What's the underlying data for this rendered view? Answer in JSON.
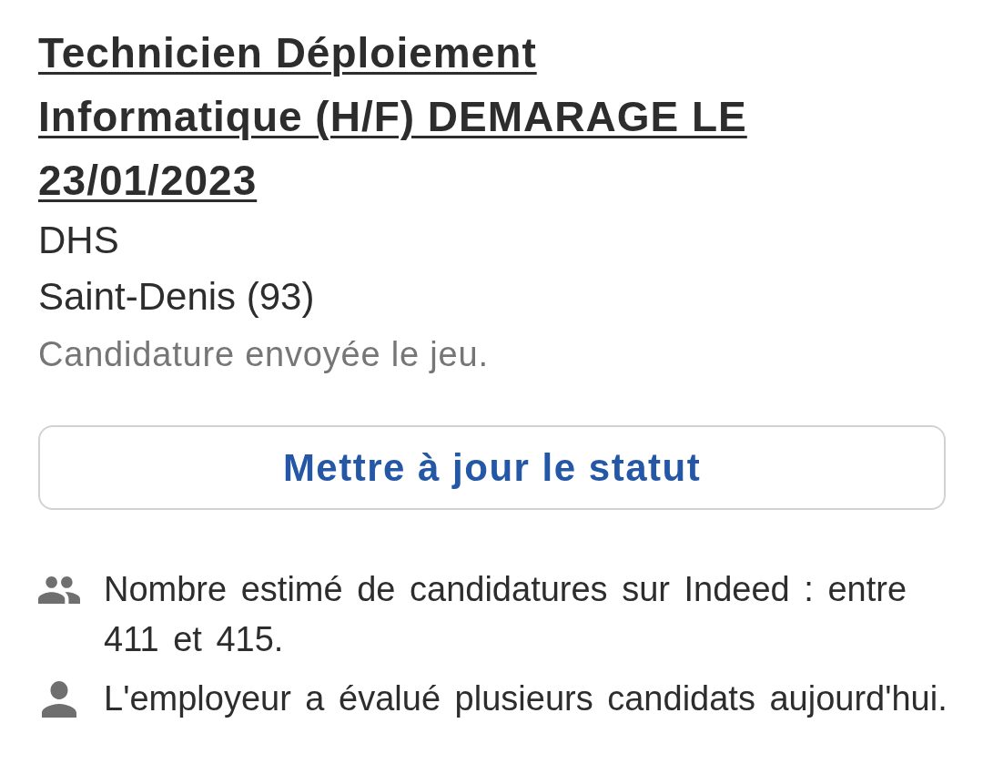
{
  "job": {
    "title": "Technicien Déploiement Informatique (H/F) DEMARAGE LE 23/01/2023",
    "company": "DHS",
    "location": "Saint-Denis (93)",
    "status": "Candidature envoyée le jeu."
  },
  "update_button": {
    "label": "Mettre à jour le statut"
  },
  "insights": [
    {
      "kind": "applicants",
      "text": "Nombre estimé de candidatures sur Indeed : entre 411 et 415."
    },
    {
      "kind": "employer",
      "text": "L'employeur a évalué plusieurs candidats aujourd'hui."
    }
  ]
}
